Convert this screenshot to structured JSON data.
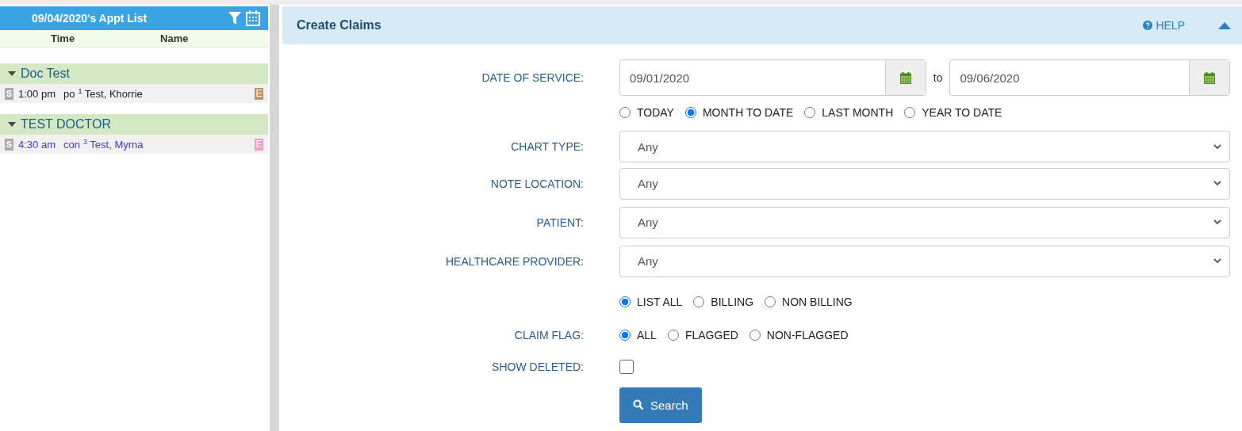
{
  "sidebar": {
    "title": "09/04/2020's Appt List",
    "columns": [
      "Time",
      "Name"
    ],
    "groups": [
      {
        "name": "Doc Test",
        "expanded": true,
        "appointments": [
          {
            "badge": "S",
            "time": "1:00 pm",
            "type": "po",
            "number": "1",
            "patient": "Test, Khorrie",
            "highlighted": false,
            "flag": "E",
            "color": "#c8935a"
          }
        ]
      },
      {
        "name": "TEST DOCTOR",
        "expanded": true,
        "appointments": [
          {
            "badge": "S",
            "time": "4:30 am",
            "type": "con",
            "number": "3",
            "patient": "Test, Myrna",
            "highlighted": true,
            "flag": "E",
            "color": "#f0a0c8"
          }
        ]
      }
    ]
  },
  "panel": {
    "title": "Create Claims",
    "help": "HELP",
    "expanded": true,
    "date_of_service": {
      "label": "DATE OF SERVICE:",
      "from": "09/01/2020",
      "separator": "to",
      "to": "09/06/2020",
      "ranges": [
        {
          "label": "TODAY",
          "selected": false
        },
        {
          "label": "MONTH TO DATE",
          "selected": true
        },
        {
          "label": "LAST MONTH",
          "selected": false
        },
        {
          "label": "YEAR TO DATE",
          "selected": false
        }
      ]
    },
    "selects": [
      {
        "label": "CHART TYPE:",
        "value": "Any"
      },
      {
        "label": "NOTE LOCATION:",
        "value": "Any"
      },
      {
        "label": "PATIENT:",
        "value": "Any"
      },
      {
        "label": "HEALTHCARE PROVIDER:",
        "value": "Any"
      }
    ],
    "billing": [
      {
        "label": "LIST ALL",
        "selected": true
      },
      {
        "label": "BILLING",
        "selected": false
      },
      {
        "label": "NON BILLING",
        "selected": false
      }
    ],
    "claim_flag": {
      "label": "CLAIM FLAG:",
      "options": [
        {
          "label": "ALL",
          "selected": true
        },
        {
          "label": "FLAGGED",
          "selected": false
        },
        {
          "label": "NON-FLAGGED",
          "selected": false
        }
      ]
    },
    "show_deleted": {
      "label": "SHOW DELETED:",
      "checked": false
    },
    "search_button": "Search"
  }
}
